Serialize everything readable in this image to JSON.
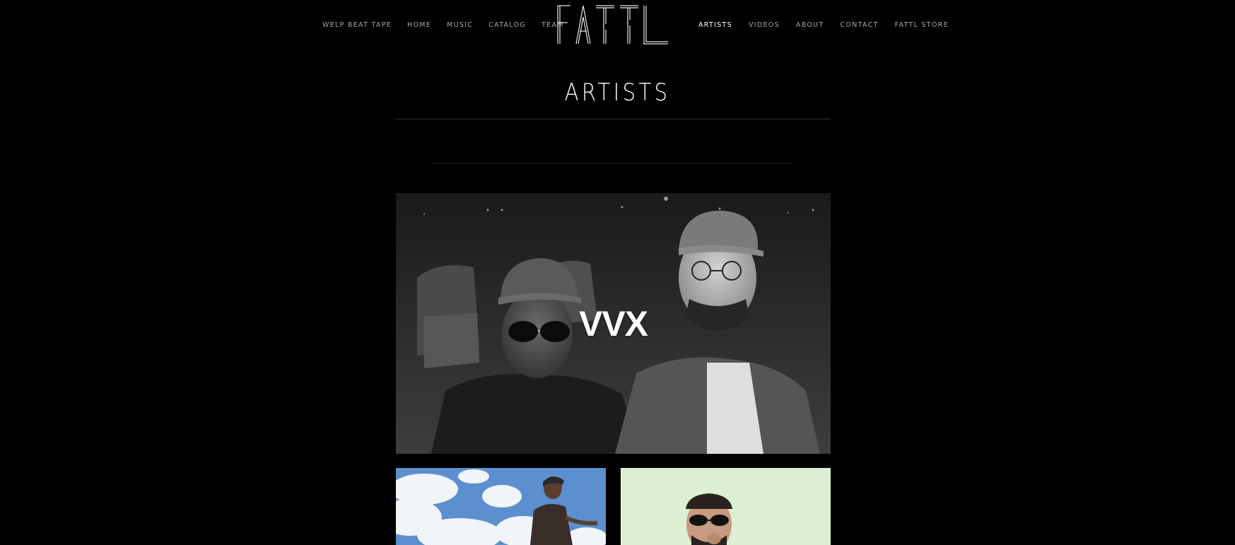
{
  "nav": {
    "left": [
      "WELP BEAT TAPE",
      "HOME",
      "MUSIC",
      "CATALOG",
      "TEAM"
    ],
    "right": [
      "ARTISTS",
      "VIDEOS",
      "ABOUT",
      "CONTACT",
      "FATTL STORE"
    ],
    "active": "ARTISTS"
  },
  "logo": {
    "text": "FATTL"
  },
  "page": {
    "title": "ARTISTS"
  },
  "featured": {
    "label": "VVX"
  },
  "colors": {
    "background": "#000000",
    "nav_text": "#a6a6a6",
    "nav_active": "#ffffff",
    "sky": "#5b8fd0",
    "mint": "#dcefd2"
  }
}
